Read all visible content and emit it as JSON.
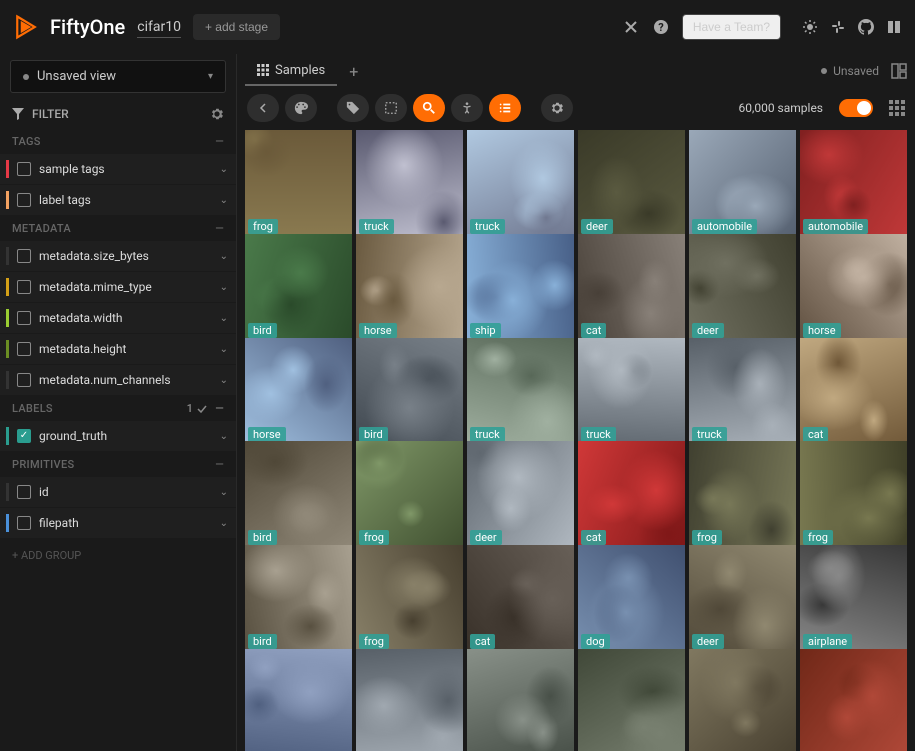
{
  "app_name": "FiftyOne",
  "dataset": "cifar10",
  "add_stage": "+ add stage",
  "have_team": "Have a Team?",
  "view_select": "Unsaved view",
  "filter_title": "FILTER",
  "sections": {
    "tags": {
      "title": "TAGS",
      "items": [
        {
          "label": "sample tags",
          "color": "#e63946",
          "checked": false
        },
        {
          "label": "label tags",
          "color": "#f4a261",
          "checked": false
        }
      ]
    },
    "metadata": {
      "title": "METADATA",
      "items": [
        {
          "label": "metadata.size_bytes",
          "color": "#333",
          "checked": false
        },
        {
          "label": "metadata.mime_type",
          "color": "#d4a017",
          "checked": false
        },
        {
          "label": "metadata.width",
          "color": "#9acd32",
          "checked": false
        },
        {
          "label": "metadata.height",
          "color": "#6b8e23",
          "checked": false
        },
        {
          "label": "metadata.num_channels",
          "color": "#333",
          "checked": false
        }
      ]
    },
    "labels": {
      "title": "LABELS",
      "count": "1",
      "items": [
        {
          "label": "ground_truth",
          "color": "#2a9d8f",
          "checked": true
        }
      ]
    },
    "primitives": {
      "title": "PRIMITIVES",
      "items": [
        {
          "label": "id",
          "color": "#333",
          "checked": false
        },
        {
          "label": "filepath",
          "color": "#4a90d9",
          "checked": false
        }
      ]
    }
  },
  "add_group": "+ ADD GROUP",
  "tabs": {
    "samples": "Samples"
  },
  "unsaved": "Unsaved",
  "sample_count": "60,000 samples",
  "grid_labels": [
    "frog",
    "truck",
    "truck",
    "deer",
    "automobile",
    "automobile",
    "bird",
    "horse",
    "ship",
    "cat",
    "deer",
    "horse",
    "horse",
    "bird",
    "truck",
    "truck",
    "truck",
    "cat",
    "bird",
    "frog",
    "deer",
    "cat",
    "frog",
    "frog",
    "bird",
    "frog",
    "cat",
    "dog",
    "deer",
    "airplane",
    "",
    "",
    "",
    "",
    "",
    ""
  ],
  "grid_colors": [
    [
      "#6b5a3a",
      "#8a7a50"
    ],
    [
      "#c0c0d0",
      "#5a5a70"
    ],
    [
      "#b0c8e0",
      "#707890"
    ],
    [
      "#5a5a40",
      "#3a3a28"
    ],
    [
      "#9aa8b8",
      "#556070"
    ],
    [
      "#c03838",
      "#802020"
    ],
    [
      "#4a7a4a",
      "#2a4a2a"
    ],
    [
      "#b8a890",
      "#6a5a40"
    ],
    [
      "#88b0d8",
      "#486088"
    ],
    [
      "#888078",
      "#484038"
    ],
    [
      "#707060",
      "#404030"
    ],
    [
      "#c0b0a0",
      "#605040"
    ],
    [
      "#a0c0e0",
      "#506080"
    ],
    [
      "#788088",
      "#404850"
    ],
    [
      "#a0b0a0",
      "#586858"
    ],
    [
      "#b0b8c0",
      "#606870"
    ],
    [
      "#a8b0b8",
      "#586068"
    ],
    [
      "#c0a880",
      "#705838"
    ],
    [
      "#908878",
      "#504838"
    ],
    [
      "#809868",
      "#405030"
    ],
    [
      "#b0b8c0",
      "#606870"
    ],
    [
      "#d03838",
      "#801818"
    ],
    [
      "#787858",
      "#404030"
    ],
    [
      "#787850",
      "#404028"
    ],
    [
      "#a8a090",
      "#585040"
    ],
    [
      "#888068",
      "#484030"
    ],
    [
      "#686058",
      "#383028"
    ],
    [
      "#7890b0",
      "#405070"
    ],
    [
      "#908870",
      "#504838"
    ],
    [
      "#888888",
      "#383838"
    ],
    [
      "#90a0c0",
      "#506080"
    ],
    [
      "#a0a8b0",
      "#586068"
    ],
    [
      "#889088",
      "#485048"
    ],
    [
      "#788070",
      "#404838"
    ],
    [
      "#807860",
      "#484030"
    ],
    [
      "#b04838",
      "#702818"
    ]
  ]
}
